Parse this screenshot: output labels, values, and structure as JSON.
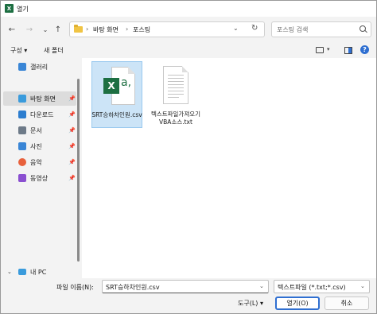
{
  "window": {
    "title": "열기",
    "app_icon_letter": "X"
  },
  "nav": {
    "back": "←",
    "forward": "→",
    "dropdown": "⌄",
    "up": "↑"
  },
  "address": {
    "breadcrumb": [
      "바탕 화면",
      "포스팅"
    ],
    "separator": "›",
    "dropdown": "⌄",
    "refresh": "↻"
  },
  "search": {
    "placeholder": "포스팅 검색"
  },
  "toolbar": {
    "organize": "구성",
    "organize_arrow": "▾",
    "new_folder": "새 폴더",
    "view_arrow": "▾",
    "help": "?"
  },
  "sidebar": {
    "items": [
      {
        "label": "갤러리",
        "icon": "gallery-icon",
        "color": "#3a86d6"
      },
      {
        "label": "바탕 화면",
        "icon": "desktop-icon",
        "color": "#3a9bdc",
        "pin": "📌",
        "selected": true
      },
      {
        "label": "다운로드",
        "icon": "download-icon",
        "color": "#2c7dcf",
        "pin": "📌"
      },
      {
        "label": "문서",
        "icon": "documents-icon",
        "color": "#6d7a88",
        "pin": "📌"
      },
      {
        "label": "사진",
        "icon": "pictures-icon",
        "color": "#3a86d6",
        "pin": "📌"
      },
      {
        "label": "음악",
        "icon": "music-icon",
        "color": "#e8613c",
        "pin": "📌"
      },
      {
        "label": "동영상",
        "icon": "videos-icon",
        "color": "#8a4fd0",
        "pin": "📌"
      },
      {
        "label": "내 PC",
        "icon": "this-pc-icon",
        "color": "#3a9bdc",
        "chevron": "⌄"
      }
    ]
  },
  "files": [
    {
      "label": "SRT승하차인원.csv",
      "icon": "excel-csv-icon",
      "badge": "X",
      "badge_suffix": "a,",
      "selected": true
    },
    {
      "label": "텍스트파일가져오기VBA소스.txt",
      "icon": "text-file-icon",
      "selected": false
    }
  ],
  "bottom": {
    "filename_label": "파일 이름(N):",
    "filename_value": "SRT승하차인원.csv",
    "filter_value": "텍스트파일 (*.txt;*.csv)",
    "dropdown": "⌄",
    "tools_label": "도구(L)",
    "tools_arrow": "▾",
    "open_label": "열기(O)",
    "cancel_label": "취소"
  },
  "colors": {
    "accent": "#2f6fd1",
    "selection": "#cce4f7",
    "excel_green": "#1d6f42"
  }
}
